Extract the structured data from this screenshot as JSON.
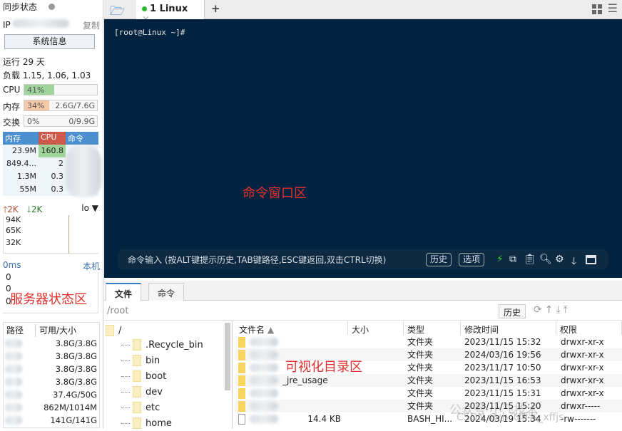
{
  "status": {
    "sync_label": "同步状态",
    "ip_label": "IP",
    "copy_label": "复制",
    "sysinfo_button": "系统信息",
    "uptime": "运行 29 天",
    "load": "负载 1.15, 1.06, 1.03",
    "cpu": {
      "label": "CPU",
      "percent": "41%",
      "value": 41
    },
    "mem": {
      "label": "内存",
      "percent": "34%",
      "amount": "2.6G/7.6G",
      "value": 34
    },
    "swap": {
      "label": "交换",
      "percent": "0%",
      "amount": "0/9.9G",
      "value": 0
    },
    "proc_headers": [
      "内存",
      "CPU",
      "命令"
    ],
    "procs": [
      {
        "mem": "23.9M",
        "cpu": "160.8"
      },
      {
        "mem": "849.4...",
        "cpu": "2"
      },
      {
        "mem": "1.3M",
        "cpu": "0.3"
      },
      {
        "mem": "55M",
        "cpu": "0.3"
      }
    ],
    "net": {
      "up": "2K",
      "down": "2K",
      "iface": "lo",
      "ticks": [
        "94K",
        "65K",
        "32K"
      ]
    },
    "ping": {
      "latency": "0ms",
      "host": "本机",
      "ticks": [
        "0",
        "0",
        "0"
      ]
    },
    "annotation": "服务器状态区",
    "disk_headers": [
      "路径",
      "可用/大小"
    ],
    "disks": [
      "3.8G/3.8G",
      "3.8G/3.8G",
      "3.8G/3.8G",
      "3.8G/3.8G",
      "37.4G/50G",
      "862M/1014M",
      "141G/141G"
    ]
  },
  "tabs": {
    "session": "1 Linux",
    "close": "×",
    "add": "+"
  },
  "terminal": {
    "prompt": "[root@Linux ~]#",
    "annotation": "命令窗口区",
    "input_hint": "命令输入 (按ALT键提示历史,TAB键路径,ESC键返回,双击CTRL切换)",
    "history_button": "历史",
    "options_button": "选项",
    "bg": "#02233f"
  },
  "bottom": {
    "tabs": [
      "文件",
      "命令"
    ],
    "path": "/root",
    "history_button": "历史",
    "tree": {
      "root": "/",
      "items": [
        ".Recycle_bin",
        "bin",
        "boot",
        "dev",
        "etc",
        "home"
      ]
    },
    "columns": [
      "文件名",
      "大小",
      "类型",
      "修改时间",
      "权限"
    ],
    "files": [
      {
        "name": "",
        "size": "",
        "type": "文件夹",
        "mtime": "2023/11/15 15:32",
        "perm": "drwxr-xr-x"
      },
      {
        "name": "",
        "size": "",
        "type": "文件夹",
        "mtime": "2024/03/16 19:56",
        "perm": "drwxr-xr-x"
      },
      {
        "name": "",
        "size": "",
        "type": "文件夹",
        "mtime": "2023/11/17 10:50",
        "perm": "drwxr-xr-x"
      },
      {
        "name": "_jre_usage",
        "size": "",
        "type": "文件夹",
        "mtime": "2023/11/15 16:53",
        "perm": "drwxr-xr-x"
      },
      {
        "name": "",
        "size": "",
        "type": "文件夹",
        "mtime": "2023/11/15 15:31",
        "perm": "drwxr-xr-x"
      },
      {
        "name": "",
        "size": "",
        "type": "文件夹",
        "mtime": "2023/11/15 15:20",
        "perm": "drwxr-----"
      },
      {
        "name": "",
        "size": "14.4 KB",
        "type": "BASH_HI...",
        "mtime": "2024/03/19 15:34",
        "perm": "-rw-------"
      }
    ],
    "annotation": "可视化目录区",
    "watermark1": "公众号·小飞技术",
    "watermark2": "CSDN @小飞博客_xffjs"
  }
}
